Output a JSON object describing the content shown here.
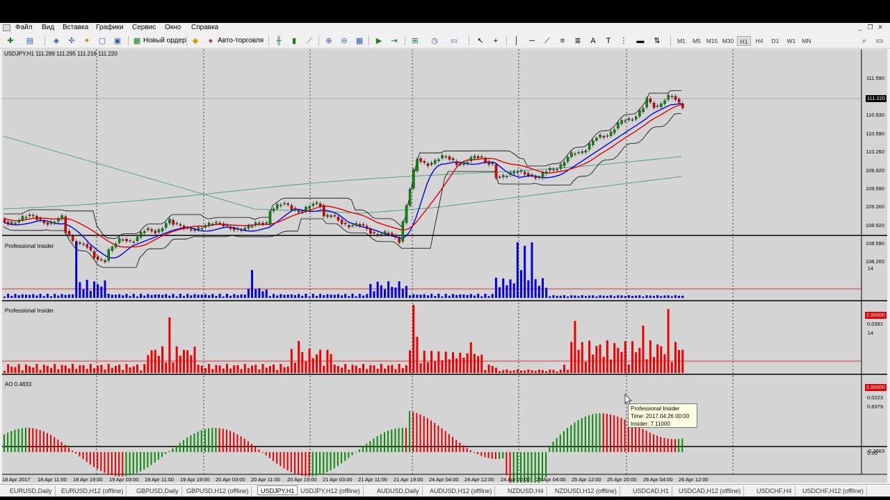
{
  "menu": {
    "items": [
      "Файл",
      "Вид",
      "Вставка",
      "Графики",
      "Сервис",
      "Окно",
      "Справка"
    ]
  },
  "toolbar": {
    "new_order_label": "Новый ордер",
    "autotrading_label": "Авто-торговля",
    "timeframes": [
      "M1",
      "M5",
      "M15",
      "M30",
      "H1",
      "H4",
      "D1",
      "W1",
      "MN"
    ],
    "active_timeframe": "H1"
  },
  "chart": {
    "symbol_header": "USDJPY,H1  111.289 111.295 111.216 111.220",
    "price_axis": [
      "111.590",
      "111.220",
      "110.930",
      "110.590",
      "110.260",
      "109.920",
      "109.590",
      "109.260",
      "108.920",
      "108.590",
      "108.260"
    ],
    "current_price": "111.220",
    "indicator1": {
      "name": "Professional Insider",
      "axis_top": "14",
      "level_tag": "2.00000",
      "axis_bottom": "0.0391"
    },
    "indicator2": {
      "name": "Professional Insider",
      "axis_top": "14",
      "level_tag": "2.00000",
      "axis_bottom": "0.0223"
    },
    "ao": {
      "name": "AO 0.4833",
      "axis_top": "0.8379",
      "axis_zero": "0.00",
      "axis_bottom": "-0.3663"
    },
    "time_axis": [
      "18 Apr 2017",
      "18 Apr 11:00",
      "18 Apr 19:00",
      "19 Apr 03:00",
      "19 Apr 11:00",
      "19 Apr 19:00",
      "20 Apr 03:00",
      "20 Apr 11:00",
      "20 Apr 19:00",
      "21 Apr 03:00",
      "21 Apr 11:00",
      "21 Apr 19:00",
      "24 Apr 04:00",
      "24 Apr 12:00",
      "24 Apr 20:00",
      "25 Apr 04:00",
      "25 Apr 12:00",
      "25 Apr 20:00",
      "26 Apr 04:00",
      "26 Apr 12:00"
    ],
    "tooltip": {
      "line1": "Professional Insider",
      "line2": "Time: 2017.04.26 00:00",
      "line3": "Insider: 7.11000"
    }
  },
  "tabs": [
    "EURUSD,Daily",
    "EURUSD,H12 (offline)",
    "GBPUSD,Daily",
    "GBPUSD,H12 (offline)",
    "USDJPY,H1",
    "USDJPY,H12 (offline)",
    "AUDUSD,Daily",
    "AUDUSD,H12 (offline)",
    "NZDUSD,H4",
    "NZDUSD,H12 (offline)",
    "USDCAD,H1",
    "USDCAD,H12 (offline)",
    "USDCHF,H4",
    "USDCHF,H12 (offline)"
  ],
  "active_tab": "USDJPY,H1",
  "colors": {
    "bull": "#0a8a0a",
    "bear": "#e00000",
    "kijun": "#e00000",
    "tenkan": "#0000e0",
    "cloud": "#000000",
    "insider_blue": "#0000dd",
    "insider_red": "#ee0000",
    "background": "#d4d4d4"
  }
}
